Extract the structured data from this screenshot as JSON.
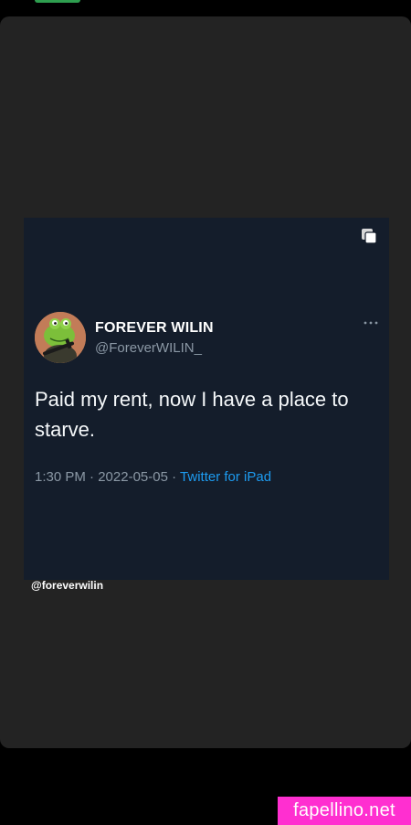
{
  "tweet": {
    "author_name": "FOREVER WILIN",
    "author_handle": "@ForeverWILIN_",
    "text": "Paid my rent, now I have a place to starve.",
    "time": "1:30 PM",
    "date": "2022-05-05",
    "source": "Twitter for iPad",
    "separator": "·"
  },
  "caption": "@foreverwilin",
  "watermark": "fapellino.net",
  "icons": {
    "copy": "copy-icon",
    "more": "more-horizontal-icon",
    "avatar": "frog-avatar"
  },
  "colors": {
    "page_background": "#000000",
    "card_background": "#232323",
    "tweet_background": "#141d2b",
    "link_blue": "#1d9bf0",
    "watermark_pink": "#ff2fd0",
    "top_indicator_green": "#2e9e4f"
  }
}
